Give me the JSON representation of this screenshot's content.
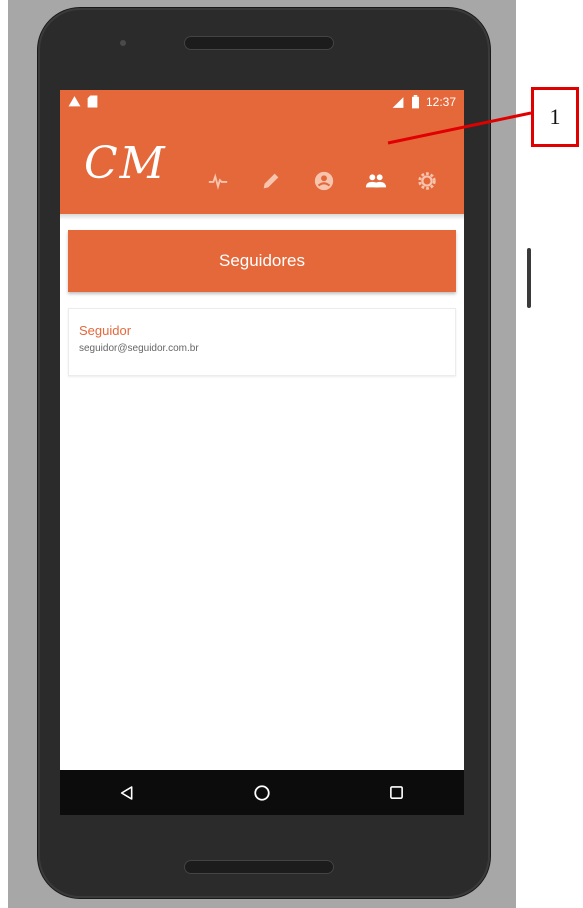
{
  "status_bar": {
    "time": "12:37",
    "left_icons": [
      "warning-icon",
      "sd-card-icon"
    ],
    "right_icons": [
      "signal-icon",
      "battery-icon"
    ]
  },
  "app_bar": {
    "logo": "CM",
    "nav_icons": [
      "pulse-icon",
      "pencil-icon",
      "account-icon",
      "group-icon",
      "settings-icon"
    ],
    "active": "group-icon",
    "color": "#e5683b"
  },
  "page": {
    "title": "Seguidores"
  },
  "followers": [
    {
      "name": "Seguidor",
      "email": "seguidor@seguidor.com.br"
    }
  ],
  "system_nav": [
    "back-icon",
    "home-icon",
    "recents-icon"
  ],
  "callout": {
    "label": "1",
    "color": "#e00000"
  }
}
